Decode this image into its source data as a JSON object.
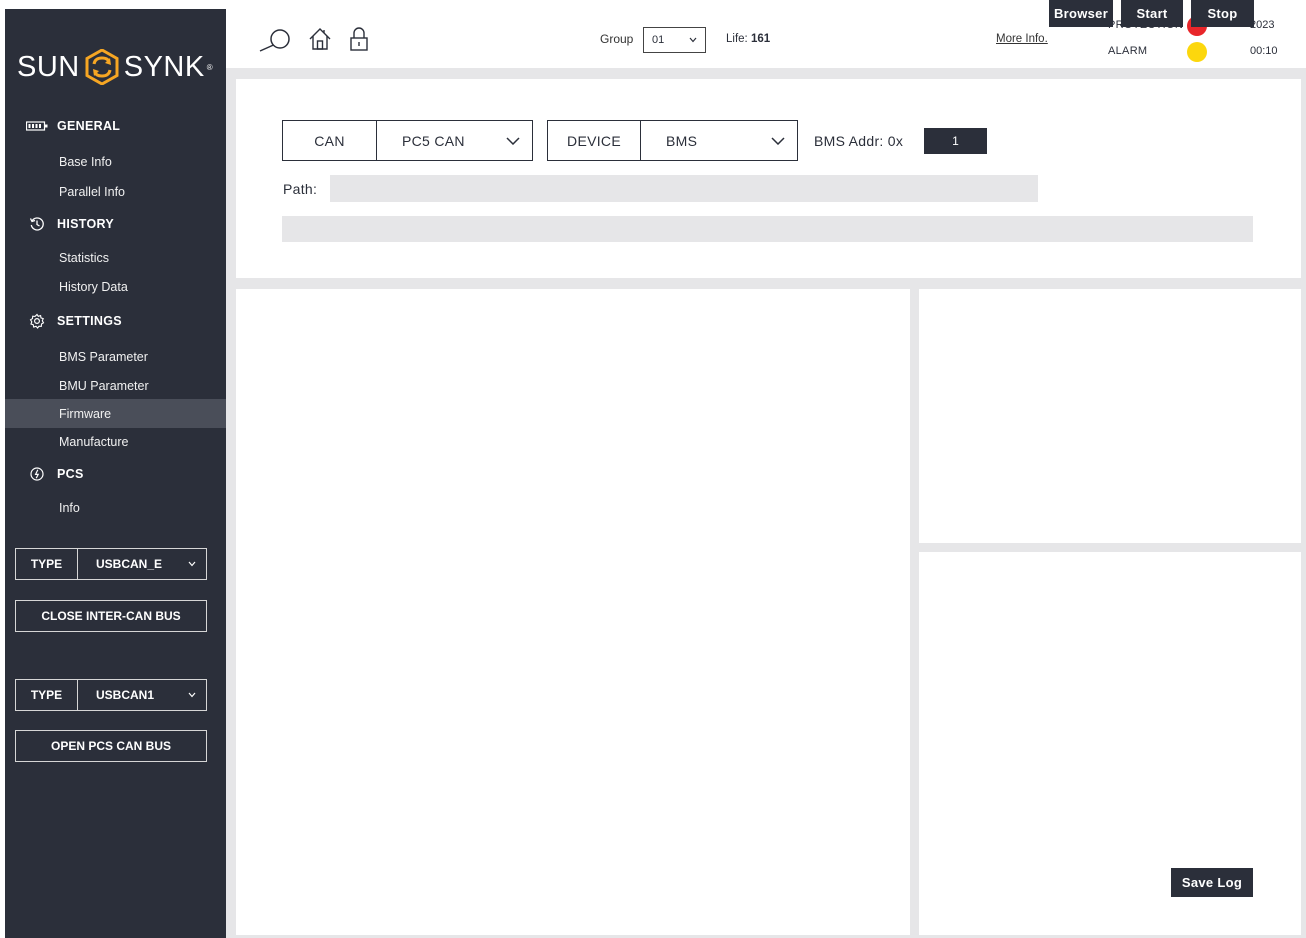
{
  "brand": {
    "left": "SUN",
    "right": "SYNK",
    "mark": "®",
    "accent": "#f6a623"
  },
  "sidebar": {
    "sections": [
      {
        "label": "GENERAL",
        "icon": "battery-icon"
      },
      {
        "label": "HISTORY",
        "icon": "history-icon"
      },
      {
        "label": "SETTINGS",
        "icon": "gear-icon"
      },
      {
        "label": "PCS",
        "icon": "power-icon"
      }
    ],
    "items": {
      "base_info": "Base Info",
      "parallel_info": "Parallel Info",
      "statistics": "Statistics",
      "history_data": "History Data",
      "bms_parameter": "BMS Parameter",
      "bmu_parameter": "BMU Parameter",
      "firmware": "Firmware",
      "manufacture": "Manufacture",
      "info": "Info"
    },
    "active_item": "Firmware",
    "type1": {
      "label": "TYPE",
      "value": "USBCAN_E"
    },
    "close_inter_can": "CLOSE INTER-CAN BUS",
    "type2": {
      "label": "TYPE",
      "value": "USBCAN1"
    },
    "open_pcs_can": "OPEN PCS CAN BUS"
  },
  "topbar": {
    "group_label": "Group",
    "group_value": "01",
    "life_label": "Life:",
    "life_value": "161",
    "more_info": "More Info.",
    "protection_label": "PROTECTION",
    "alarm_label": "ALARM",
    "protection_color": "#e8262a",
    "alarm_color": "#fcd70d",
    "year": "2023",
    "time": "00:10"
  },
  "firmware": {
    "can_label": "CAN",
    "can_value": "PC5 CAN",
    "device_label": "DEVICE",
    "device_value": "BMS",
    "bms_addr_label": "BMS Addr: 0x",
    "bms_addr_value": "1",
    "path_label": "Path:",
    "path_value": "",
    "browser_button": "Browser",
    "start_button": "Start",
    "stop_button": "Stop",
    "progress": 0,
    "save_log_button": "Save Log"
  },
  "colors": {
    "sidebar_bg": "#2b2f3a",
    "active_bg": "#4a4e59",
    "panel_bg": "#e6e6e8"
  }
}
